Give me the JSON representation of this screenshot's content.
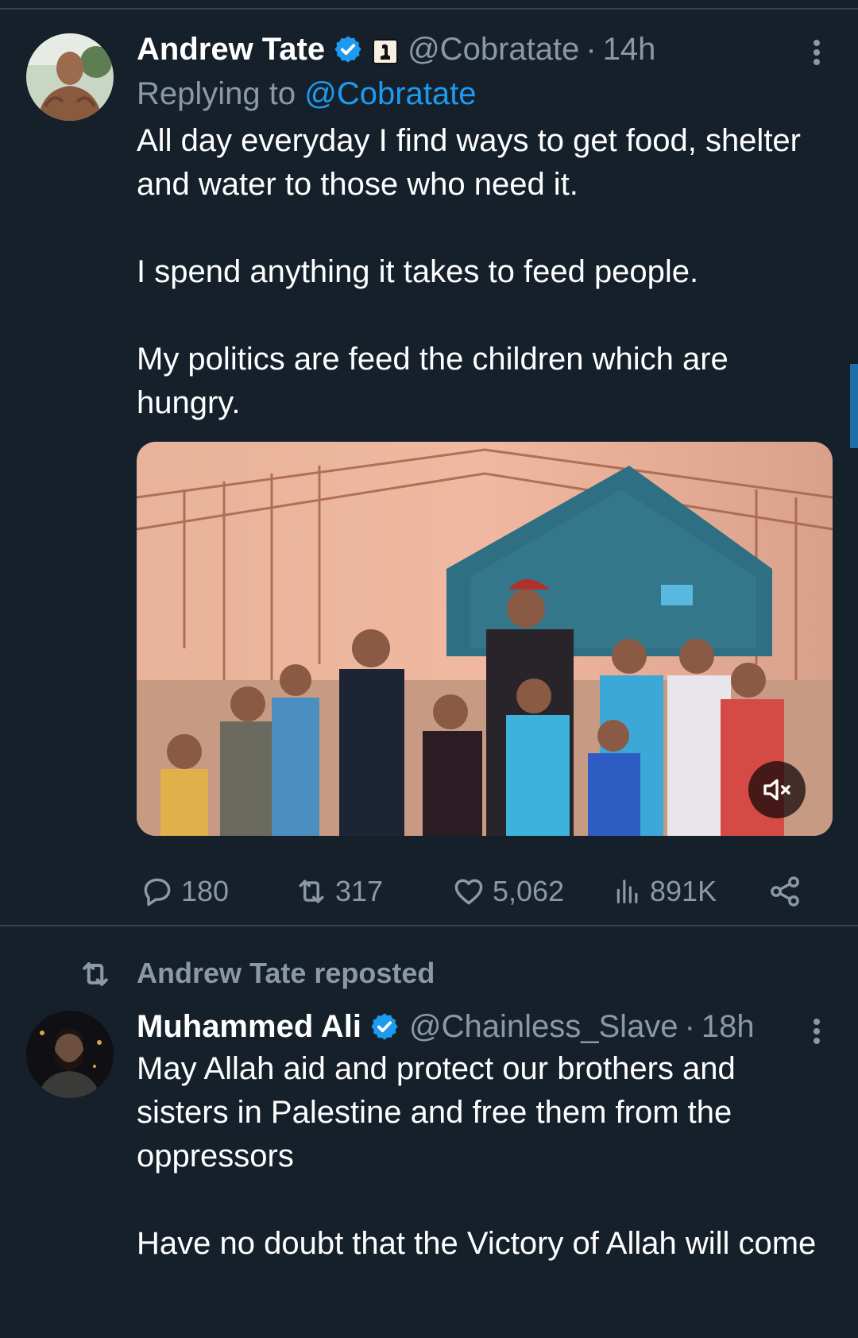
{
  "tweets": [
    {
      "name": "Andrew Tate",
      "handle": "@Cobratate",
      "time": "14h",
      "dot": "·",
      "replying_prefix": "Replying to ",
      "replying_to": "@Cobratate",
      "text": "All day everyday I find ways to get food, shelter and water to those who need it.\n\nI spend anything it takes to feed people.\n\nMy politics are feed the children which are hungry.",
      "stats": {
        "replies": "180",
        "reposts": "317",
        "likes": "5,062",
        "views": "891K"
      },
      "verified": true,
      "media_type": "video",
      "media_muted": true
    },
    {
      "repost_label": "Andrew Tate reposted",
      "name": "Muhammed Ali",
      "handle": "@Chainless_Slave",
      "time": "18h",
      "dot": "·",
      "text": "May Allah aid and protect our brothers and sisters in Palestine and free them from the oppressors\n\nHave no doubt that the Victory of Allah will come",
      "verified": true
    }
  ],
  "icons": {
    "verified": "verified-badge-icon",
    "affiliate": "affiliate-badge-icon",
    "more": "more-dots-icon",
    "reply": "reply-bubble-icon",
    "repost": "repost-icon",
    "like": "heart-icon",
    "views": "views-bars-icon",
    "share": "share-icon",
    "mute": "muted-speaker-icon"
  },
  "colors": {
    "background": "#15202b",
    "accent": "#1d9bf0",
    "muted_text": "#8b98a5",
    "divider": "#38444d"
  }
}
